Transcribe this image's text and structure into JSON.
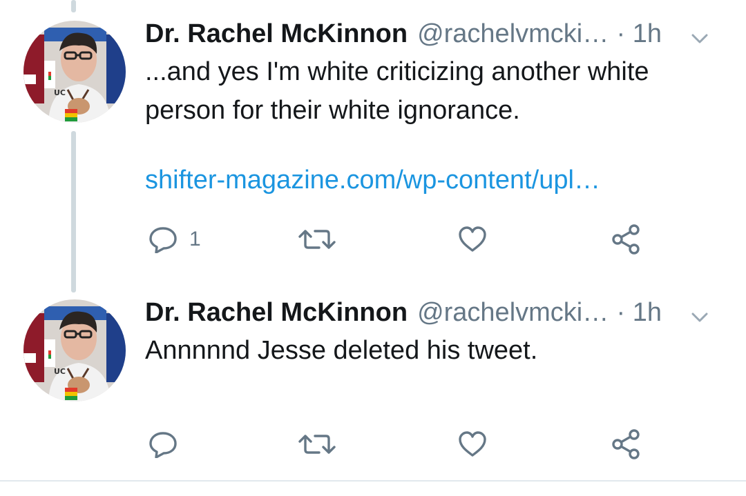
{
  "tweets": [
    {
      "author_name": "Dr. Rachel McKinnon",
      "handle": "@rachelvmcki…",
      "time": "· 1h",
      "text": "...and yes I'm white criticizing another white person for their white ignorance.",
      "link": "shifter-magazine.com/wp-content/upl…",
      "reply_count": "1"
    },
    {
      "author_name": "Dr. Rachel McKinnon",
      "handle": "@rachelvmcki…",
      "time": "· 1h",
      "text": "Annnnnd Jesse deleted his tweet.",
      "reply_count": ""
    }
  ],
  "icons": {
    "reply": "reply-icon",
    "retweet": "retweet-icon",
    "like": "heart-icon",
    "share": "share-icon",
    "menu": "chevron-down-icon"
  },
  "colors": {
    "link": "#1b95e0",
    "secondary_text": "#657786",
    "thread_line": "#cfd9de",
    "divider": "#e1e8ed"
  }
}
